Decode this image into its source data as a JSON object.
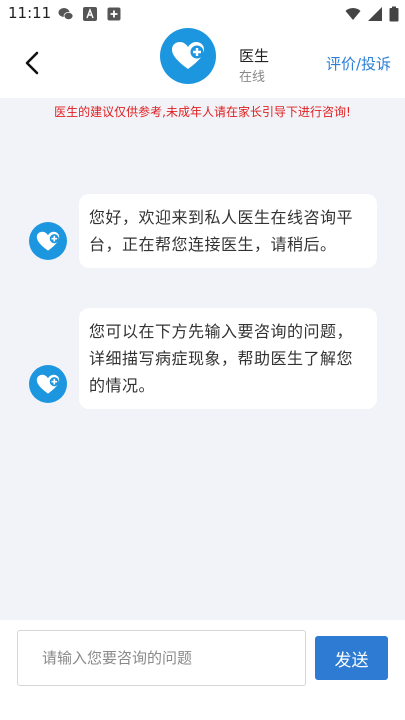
{
  "status_bar": {
    "time": "11:11",
    "left_icons": [
      "wechat-icon",
      "text-a-icon",
      "plus-box-icon"
    ],
    "right_icons": [
      "wifi-icon",
      "signal-icon",
      "battery-icon"
    ]
  },
  "header": {
    "back_icon": "chevron-left-icon",
    "doctor_name": "医生",
    "doctor_status": "在线",
    "review_label": "评价/投诉"
  },
  "chat": {
    "notice": "医生的建议仅供参考,未成年人请在家长引导下进行咨询!",
    "messages": [
      {
        "sender": "doctor",
        "text": "您好，欢迎来到私人医生在线咨询平台，正在帮您连接医生，请稍后。"
      },
      {
        "sender": "doctor",
        "text": "您可以在下方先输入要咨询的问题，详细描写病症现象，帮助医生了解您的情况。"
      }
    ]
  },
  "input": {
    "placeholder": "请输入您要咨询的问题",
    "value": "",
    "send_label": "发送"
  },
  "colors": {
    "accent": "#1d96e0",
    "send_button": "#2d7bd2",
    "link": "#2b7fd6",
    "notice": "#e02020",
    "chat_bg": "#f2f3f8"
  }
}
